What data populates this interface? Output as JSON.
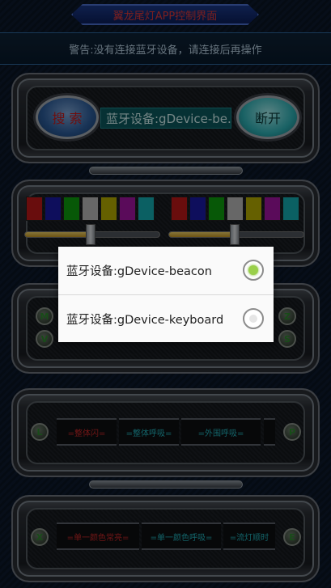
{
  "header": {
    "title": "翼龙尾灯APP控制界面",
    "warning": "警告:没有连接蓝牙设备，请连接后再操作"
  },
  "connect_panel": {
    "search_label": "搜 索",
    "device_display": "蓝牙设备:gDevice-be..",
    "disconnect_label": "断开"
  },
  "colors": {
    "left_swatches": [
      "#c01818",
      "#1a1aa8",
      "#0da00d",
      "#bcbcbc",
      "#b8b000",
      "#a414a4",
      "#14b0b4"
    ],
    "right_swatches": [
      "#c01818",
      "#1a1aa8",
      "#0da00d",
      "#bcbcbc",
      "#b8b000",
      "#a414a4",
      "#14b0b4"
    ],
    "left_slider_level": 0.48,
    "right_slider_level": 0.48
  },
  "mode_panel": {
    "btn_m": "M",
    "btn_v": "V",
    "btn_z": "Z",
    "btn_s": "S"
  },
  "effect_panel1": {
    "left_btn": "L",
    "right_btn": "P",
    "cells": [
      "=整体闪=",
      "=整体呼吸=",
      "=外围呼吸="
    ]
  },
  "effect_panel2": {
    "left_btn": "X",
    "right_btn": "E",
    "cells": [
      "=单一颜色常亮=",
      "=单一颜色呼吸=",
      "=流灯顺时"
    ]
  },
  "dialog": {
    "options": [
      {
        "label": "蓝牙设备:gDevice-beacon",
        "selected": true
      },
      {
        "label": "蓝牙设备:gDevice-keyboard",
        "selected": false
      }
    ]
  }
}
